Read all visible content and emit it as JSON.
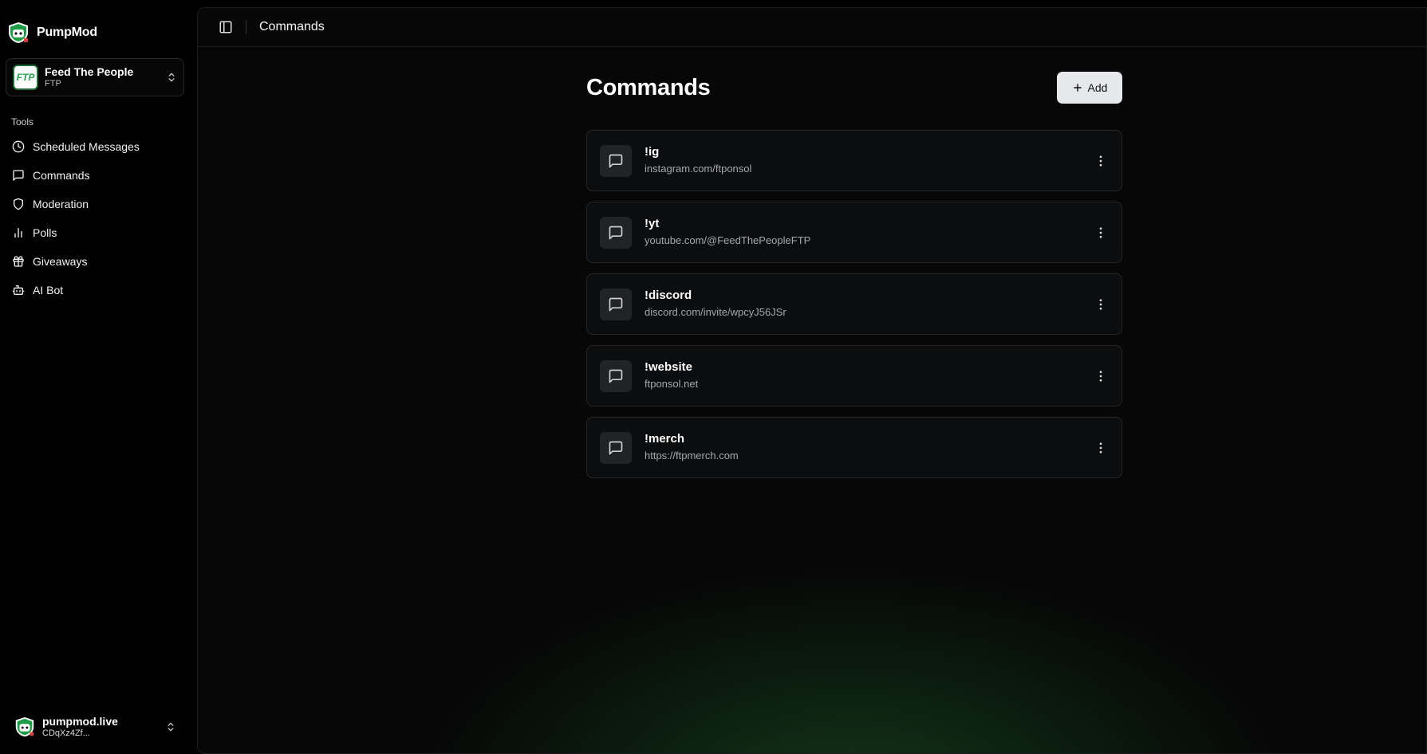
{
  "brand": {
    "name": "PumpMod"
  },
  "team": {
    "name": "Feed The People",
    "ticker": "FTP",
    "avatar_text": "FTP"
  },
  "sidebar": {
    "section_label": "Tools",
    "items": [
      {
        "label": "Scheduled Messages",
        "icon": "clock-icon"
      },
      {
        "label": "Commands",
        "icon": "message-square-icon"
      },
      {
        "label": "Moderation",
        "icon": "shield-icon"
      },
      {
        "label": "Polls",
        "icon": "bar-chart-icon"
      },
      {
        "label": "Giveaways",
        "icon": "gift-icon"
      },
      {
        "label": "AI Bot",
        "icon": "bot-icon"
      }
    ]
  },
  "account": {
    "name": "pumpmod.live",
    "address": "CDqXz4Zf..."
  },
  "topbar": {
    "title": "Commands"
  },
  "page": {
    "title": "Commands",
    "add_label": "Add",
    "commands": [
      {
        "name": "!ig",
        "response": "instagram.com/ftponsol"
      },
      {
        "name": "!yt",
        "response": "youtube.com/@FeedThePeopleFTP"
      },
      {
        "name": "!discord",
        "response": "discord.com/invite/wpcyJ56JSr"
      },
      {
        "name": "!website",
        "response": "ftponsol.net"
      },
      {
        "name": "!merch",
        "response": "https://ftpmerch.com"
      }
    ]
  },
  "colors": {
    "accent_green": "#22a34a",
    "button_bg": "#e6e8ec",
    "card_bg": "#0c0d0e"
  }
}
